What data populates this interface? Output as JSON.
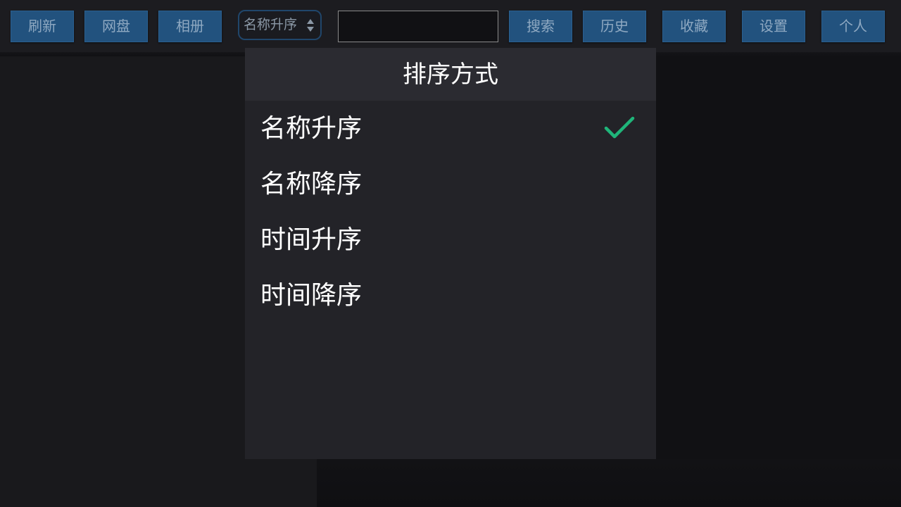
{
  "toolbar": {
    "refresh_label": "刷新",
    "cloud_label": "网盘",
    "album_label": "相册",
    "sort_select_value": "名称升序",
    "search_value": "",
    "search_label": "搜索",
    "history_label": "历史",
    "favorites_label": "收藏",
    "settings_label": "设置",
    "profile_label": "个人",
    "button_color": "#22527e"
  },
  "sort_dialog": {
    "title": "排序方式",
    "options": [
      {
        "label": "名称升序",
        "selected": true
      },
      {
        "label": "名称降序",
        "selected": false
      },
      {
        "label": "时间升序",
        "selected": false
      },
      {
        "label": "时间降序",
        "selected": false
      }
    ],
    "check_icon": "check-icon",
    "check_color": "#1fb57a"
  }
}
